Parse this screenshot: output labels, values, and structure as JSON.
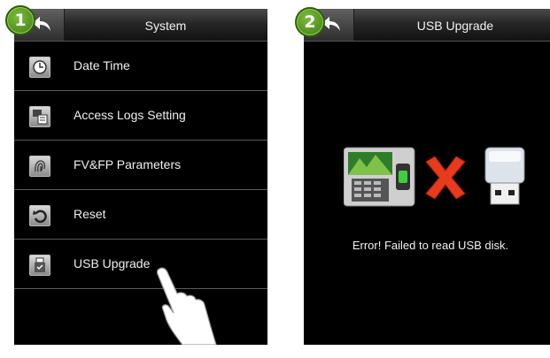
{
  "screen1": {
    "badge": "1",
    "title": "System",
    "menu": [
      {
        "label": "Date Time",
        "icon": "clock-icon"
      },
      {
        "label": "Access Logs Setting",
        "icon": "logs-icon"
      },
      {
        "label": "FV&FP Parameters",
        "icon": "fingerprint-icon"
      },
      {
        "label": "Reset",
        "icon": "reset-icon"
      },
      {
        "label": "USB Upgrade",
        "icon": "usb-upgrade-icon"
      }
    ]
  },
  "screen2": {
    "badge": "2",
    "title": "USB Upgrade",
    "error_message": "Error! Failed to read USB disk."
  },
  "colors": {
    "badge": "#5a9e1f",
    "error_x": "#e83a1c",
    "screen_bg": "#000000"
  }
}
